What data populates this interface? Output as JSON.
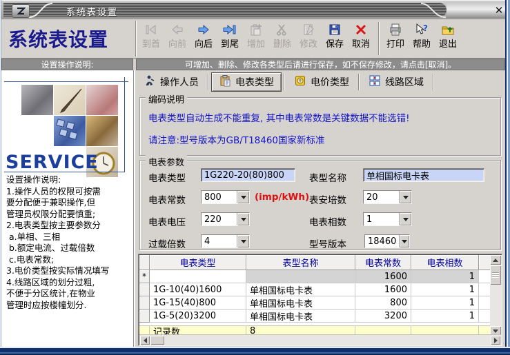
{
  "window": {
    "title": "系统表设置",
    "close_glyph": "✕",
    "app_title": "系统表设置"
  },
  "toolbar": {
    "buttons": [
      {
        "label": "到首",
        "icon": "go-first-icon",
        "enabled": false
      },
      {
        "label": "向前",
        "icon": "go-previous-icon",
        "enabled": false
      },
      {
        "label": "向后",
        "icon": "go-next-icon",
        "enabled": true
      },
      {
        "label": "到尾",
        "icon": "go-last-icon",
        "enabled": true
      },
      {
        "label": "增加",
        "icon": "add-icon",
        "enabled": false
      },
      {
        "label": "删除",
        "icon": "delete-icon",
        "enabled": false
      },
      {
        "label": "修改",
        "icon": "modify-icon",
        "enabled": false
      },
      {
        "label": "保存",
        "icon": "save-icon",
        "enabled": true
      },
      {
        "label": "取消",
        "icon": "cancel-icon",
        "enabled": true
      },
      {
        "label": "打印",
        "icon": "print-icon",
        "enabled": true
      },
      {
        "label": "帮助",
        "icon": "help-icon",
        "enabled": true
      },
      {
        "label": "退出",
        "icon": "exit-icon",
        "enabled": true
      }
    ]
  },
  "left_panel": {
    "caption": "设置操作说明:",
    "service_text": "SERVICE",
    "instructions": "设置操作说明:\n1.操作人员的权限可按需\n要分配便于兼职操作,但\n管理员权限分配要慎重;\n2.电表类型按主要参数分\n a.单相、三相\n b.额定电流、过载倍数\n c.电表常数;\n3.电价类型按实际情况填写\n4.线路区域的划分过粗,\n不便于分区统计,在物业\n管理时应按楼幢划分."
  },
  "message_bar": "可增加、删除、修改各类型后请进行保存，如不保存修改，请点击[取消]。",
  "tabs": [
    {
      "label": "操作人员",
      "icon": "operator-person-icon",
      "selected": false
    },
    {
      "label": "电表类型",
      "icon": "meter-clipboard-icon",
      "selected": true
    },
    {
      "label": "电价类型",
      "icon": "price-book-icon",
      "selected": false
    },
    {
      "label": "线路区域",
      "icon": "line-area-icon",
      "selected": false
    }
  ],
  "notice": {
    "title": "编码说明",
    "line1": "电表类型自动生成不能重复, 其中电表常数是关键数据不能选错!",
    "line2": "请注意:型号版本为GB/T18460国家新标准"
  },
  "form": {
    "title": "电表参数",
    "meter_type": {
      "label": "电表类型",
      "value": "1G220-20(80)800"
    },
    "model_name": {
      "label": "表型名称",
      "value": "单相国标电卡表"
    },
    "meter_constant": {
      "label": "电表常数",
      "value": "800",
      "unit": "(imp/kWh)"
    },
    "ampere": {
      "label": "表安培数",
      "value": "20"
    },
    "voltage": {
      "label": "电表电压",
      "value": "220"
    },
    "phases": {
      "label": "电表相数",
      "value": "1"
    },
    "overload": {
      "label": "过载倍数",
      "value": "4"
    },
    "model_version": {
      "label": "型号版本",
      "value": "18460"
    }
  },
  "grid": {
    "headers": [
      "电表类型",
      "表型名称",
      "电表常数",
      "电表相数"
    ],
    "new_row": {
      "marker": "*",
      "type": "",
      "name": "",
      "constant": "1600",
      "phases": "1"
    },
    "rows": [
      {
        "type": "1G-10(40)1600",
        "name": "单相国标电卡表",
        "constant": "1600",
        "phases": "1"
      },
      {
        "type": "1G-15(40)800",
        "name": "单相国标电卡表",
        "constant": "800",
        "phases": "1"
      },
      {
        "type": "1G-5(20)3200",
        "name": "单相国标电卡表",
        "constant": "3200",
        "phases": "1"
      }
    ],
    "footer": {
      "label": "记录数",
      "value": "8"
    }
  },
  "colors": {
    "accent_navy": "#000080",
    "note_blue": "#1414c8",
    "alert_red": "#dd1111",
    "input_lavender": "#c9d5f7",
    "footer_yellow": "#ffffcc",
    "chrome_gray": "#d6d3ce",
    "caption_gray": "#8c8c8c"
  }
}
